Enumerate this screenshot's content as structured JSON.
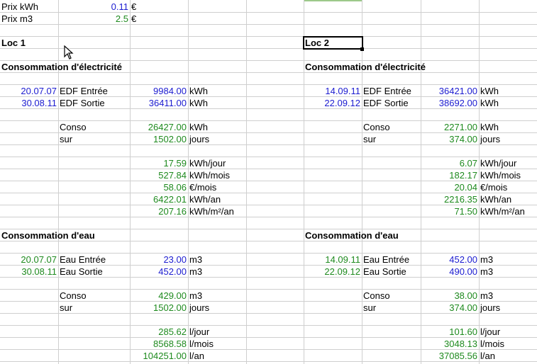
{
  "colors": {
    "blue": "#1b1bd0",
    "green": "#1e8a1e",
    "black": "#000000",
    "grid": "#cfcfcf"
  },
  "top": {
    "prix_kwh_label": "Prix kWh",
    "prix_kwh_value": "0.11",
    "prix_kwh_unit": "€",
    "prix_m3_label": "Prix m3",
    "prix_m3_value": "2.5",
    "prix_m3_unit": "€"
  },
  "loc1": {
    "title": "Loc 1",
    "elec_title": "Consommation d'électricité",
    "elec_in_date": "20.07.07",
    "elec_in_label": "EDF Entrée",
    "elec_in_value": "9984.00",
    "elec_in_unit": "kWh",
    "elec_out_date": "30.08.11",
    "elec_out_label": "EDF Sortie",
    "elec_out_value": "36411.00",
    "elec_out_unit": "kWh",
    "conso_label": "Conso",
    "conso_value": "26427.00",
    "conso_unit": "kWh",
    "sur_label": "sur",
    "sur_value": "1502.00",
    "sur_unit": "jours",
    "day_value": "17.59",
    "day_unit": "kWh/jour",
    "month_value": "527.84",
    "month_unit": "kWh/mois",
    "eur_value": "58.06",
    "eur_unit": "€/mois",
    "year_value": "6422.01",
    "year_unit": "kWh/an",
    "m2_value": "207.16",
    "m2_unit": "kWh/m²/an",
    "water_title": "Consommation d'eau",
    "water_in_date": "20.07.07",
    "water_in_label": "Eau Entrée",
    "water_in_value": "23.00",
    "water_in_unit": "m3",
    "water_out_date": "30.08.11",
    "water_out_label": "Eau Sortie",
    "water_out_value": "452.00",
    "water_out_unit": "m3",
    "wconso_label": "Conso",
    "wconso_value": "429.00",
    "wconso_unit": "m3",
    "wsur_label": "sur",
    "wsur_value": "1502.00",
    "wsur_unit": "jours",
    "wday_value": "285.62",
    "wday_unit": "l/jour",
    "wmonth_value": "8568.58",
    "wmonth_unit": "l/mois",
    "wyear_value": "104251.00",
    "wyear_unit": "l/an"
  },
  "loc2": {
    "title": "Loc 2",
    "elec_title": "Consommation d'électricité",
    "elec_in_date": "14.09.11",
    "elec_in_label": "EDF Entrée",
    "elec_in_value": "36421.00",
    "elec_in_unit": "kWh",
    "elec_out_date": "22.09.12",
    "elec_out_label": "EDF Sortie",
    "elec_out_value": "38692.00",
    "elec_out_unit": "kWh",
    "conso_label": "Conso",
    "conso_value": "2271.00",
    "conso_unit": "kWh",
    "sur_label": "sur",
    "sur_value": "374.00",
    "sur_unit": "jours",
    "day_value": "6.07",
    "day_unit": "kWh/jour",
    "month_value": "182.17",
    "month_unit": "kWh/mois",
    "eur_value": "20.04",
    "eur_unit": "€/mois",
    "year_value": "2216.35",
    "year_unit": "kWh/an",
    "m2_value": "71.50",
    "m2_unit": "kWh/m²/an",
    "water_title": "Consommation d'eau",
    "water_in_date": "14.09.11",
    "water_in_label": "Eau Entrée",
    "water_in_value": "452.00",
    "water_in_unit": "m3",
    "water_out_date": "22.09.12",
    "water_out_label": "Eau Sortie",
    "water_out_value": "490.00",
    "water_out_unit": "m3",
    "wconso_label": "Conso",
    "wconso_value": "38.00",
    "wconso_unit": "m3",
    "wsur_label": "sur",
    "wsur_value": "374.00",
    "wsur_unit": "jours",
    "wday_value": "101.60",
    "wday_unit": "l/jour",
    "wmonth_value": "3048.13",
    "wmonth_unit": "l/mois",
    "wyear_value": "37085.56",
    "wyear_unit": "l/an"
  }
}
